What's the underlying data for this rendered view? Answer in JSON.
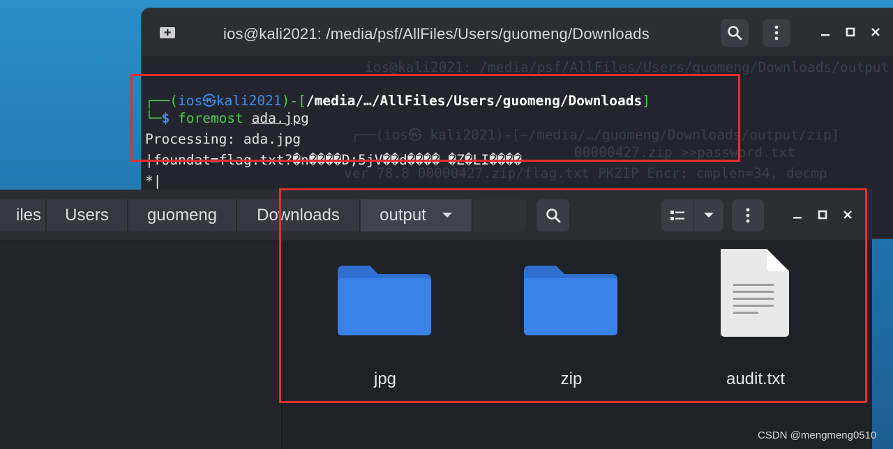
{
  "terminal": {
    "title": "ios@kali2021: /media/psf/AllFiles/Users/guomeng/Downloads",
    "ghost_lines": [
      "ios@kali2021: /media/psf/AllFiles/Users/guomeng/Downloads/output",
      "┌──(ios㉿ kali2021)-[~/media/…/guomeng/Downloads/output/zip]",
      "00000427.zip >>password.txt",
      "ver 78.8 00000427.zip/flag.txt PKZIP Encr: cmplen=34, decmp"
    ],
    "prompt": {
      "corner_top": "┌──(",
      "user": "ios",
      "skull": "㉿",
      "host": "kali2021",
      "mid": ")-[",
      "path": "/media/…/AllFiles/Users/guomeng/Downloads",
      "end": "]",
      "corner_bottom": "└─",
      "dollar": "$",
      "command": "foremost",
      "argument": "ada.jpg"
    },
    "output_lines": [
      "Processing: ada.jpg",
      "|foundat=flag.txt?�n����D;5jV��d����-�Z�LI����",
      "*|"
    ]
  },
  "file_manager": {
    "breadcrumbs": [
      "iles",
      "Users",
      "guomeng",
      "Downloads",
      "output"
    ],
    "items": [
      {
        "name": "jpg",
        "icon": "folder-icon"
      },
      {
        "name": "zip",
        "icon": "folder-icon"
      },
      {
        "name": "audit.txt",
        "icon": "text-file-icon"
      }
    ],
    "folder_color": "#3b82e8",
    "file_color": "#e9e9e9"
  },
  "highlight_color": "#e3312a",
  "watermark": "CSDN @mengmeng0510"
}
